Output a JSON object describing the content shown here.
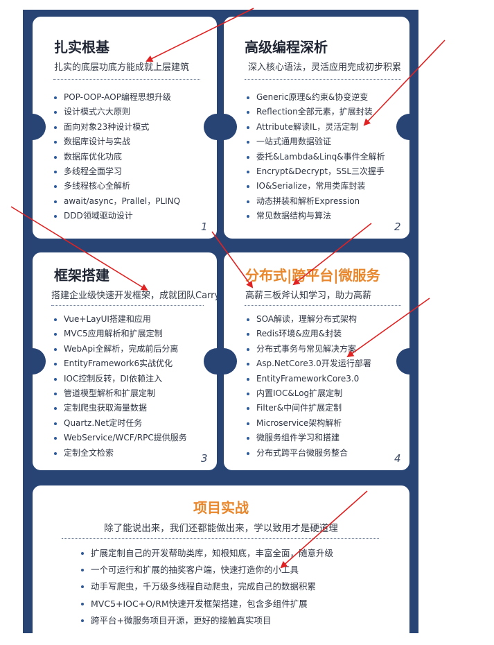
{
  "cards": [
    {
      "title": "扎实根基",
      "subtitle": "扎实的底层功底方能成就上层建筑",
      "number": "1",
      "items": [
        "POP-OOP-AOP编程思想升级",
        "设计模式六大原则",
        "面向对象23种设计模式",
        "数据库设计与实战",
        "数据库优化功底",
        "多线程全面学习",
        "多线程核心全解析",
        "await/async，Prallel，PLINQ",
        "DDD领域驱动设计"
      ]
    },
    {
      "title": "高级编程深析",
      "subtitle": "深入核心语法，灵活应用完成初步积累",
      "number": "2",
      "items": [
        "Generic原理&约束&协变逆变",
        "Reflection全部元素，扩展封装",
        "Attribute解读IL，灵活定制",
        "一站式通用数据验证",
        "委托&Lambda&Linq&事件全解析",
        "Encrypt&Decrypt，SSL三次握手",
        "IO&Serialize，常用类库封装",
        "动态拼装和解析Expression",
        "常见数据结构与算法"
      ]
    },
    {
      "title": "框架搭建",
      "subtitle": "搭建企业级快速开发框架，成就团队Carry",
      "number": "3",
      "items": [
        "Vue+LayUI搭建和应用",
        "MVC5应用解析和扩展定制",
        "WebApi全解析，完成前后分离",
        "EntityFramework6实战优化",
        "IOC控制反转，DI依赖注入",
        "管道模型解析和扩展定制",
        "定制爬虫获取海量数据",
        "Quartz.Net定时任务",
        "WebService/WCF/RPC提供服务",
        "定制全文检索"
      ]
    },
    {
      "title": "分布式|跨平台|微服务",
      "subtitle": "高薪三板斧认知学习，助力高薪",
      "number": "4",
      "items": [
        "SOA解读，理解分布式架构",
        "Redis环境&应用&封装",
        "分布式事务与常见解决方案",
        "Asp.NetCore3.0开发运行部署",
        "EntityFrameworkCore3.0",
        "内置IOC&Log扩展定制",
        "Filter&中间件扩展定制",
        "Microservice架构解析",
        "微服务组件学习和搭建",
        "分布式跨平台微服务整合"
      ]
    }
  ],
  "project": {
    "title": "项目实战",
    "subtitle": "除了能说出来，我们还都能做出来，学以致用才是硬道理",
    "items": [
      "扩展定制自己的开发帮助类库，知根知底，丰富全面，随意升级",
      "一个可运行和扩展的抽奖客户端，快速打造你的小工具",
      "动手写爬虫，千万级多线程自动爬虫，完成自己的数据积累",
      "MVC5+IOC+O/RM快速开发框架搭建，包含多组件扩展",
      "跨平台+微服务项目开源，更好的接触真实项目"
    ]
  },
  "colors": {
    "board": "#284475",
    "accent_orange": "#e8872c",
    "annotation_red": "#e02222"
  }
}
